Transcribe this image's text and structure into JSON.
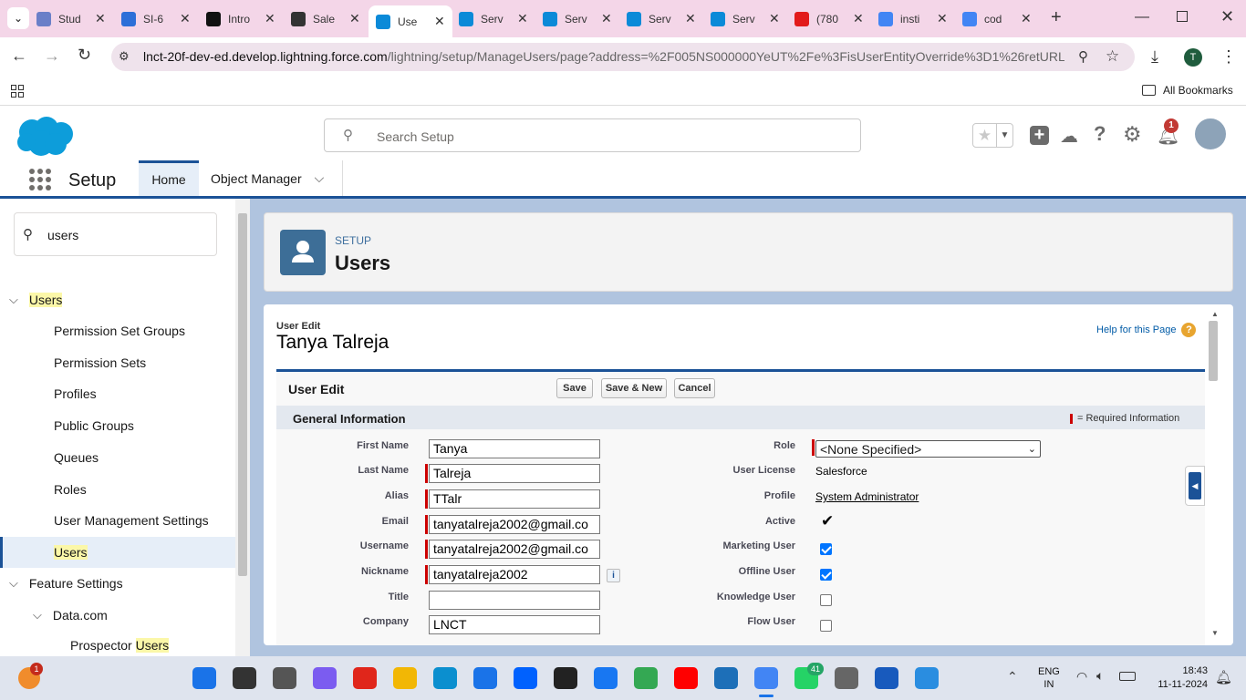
{
  "browser": {
    "tabs": [
      {
        "title": "Stud",
        "color": "#6a7fc8"
      },
      {
        "title": "SI-6",
        "color": "#2d6fd8"
      },
      {
        "title": "Intro",
        "color": "#111111"
      },
      {
        "title": "Sale",
        "color": "#333333"
      },
      {
        "title": "Use",
        "color": "#0b8ad8",
        "active": true
      },
      {
        "title": "Serv",
        "color": "#0b8ad8"
      },
      {
        "title": "Serv",
        "color": "#0b8ad8"
      },
      {
        "title": "Serv",
        "color": "#0b8ad8"
      },
      {
        "title": "Serv",
        "color": "#0b8ad8"
      },
      {
        "title": "(780",
        "color": "#e21b1b"
      },
      {
        "title": "insti",
        "color": "#4285f4"
      },
      {
        "title": "cod",
        "color": "#4285f4"
      }
    ],
    "url_host": "lnct-20f-dev-ed.develop.lightning.force.com",
    "url_path": "/lightning/setup/ManageUsers/page?address=%2F005NS000000YeUT%2Fe%3FisUserEntityOverride%3D1%26retURL...",
    "profile_initial": "T",
    "all_bookmarks": "All Bookmarks"
  },
  "sf": {
    "search_placeholder": "Search Setup",
    "notification_count": "1",
    "app_name": "Setup",
    "nav_home": "Home",
    "nav_object_manager": "Object Manager"
  },
  "sidebar": {
    "search_value": "users",
    "users": "Users",
    "items": [
      "Permission Set Groups",
      "Permission Sets",
      "Profiles",
      "Public Groups",
      "Queues",
      "Roles",
      "User Management Settings",
      "Users"
    ],
    "feature_settings": "Feature Settings",
    "data_com": "Data.com",
    "prospector_prefix": "Prospector ",
    "prospector_hl": "Users"
  },
  "page": {
    "eyebrow": "SETUP",
    "title": "Users",
    "user_edit_small": "User Edit",
    "user_name": "Tanya Talreja",
    "help_link": "Help for this Page",
    "section_title": "User Edit",
    "btn_save": "Save",
    "btn_save_new": "Save & New",
    "btn_cancel": "Cancel",
    "general_info": "General Information",
    "required_info": "= Required Information"
  },
  "form": {
    "left": [
      {
        "label": "First Name",
        "value": "Tanya",
        "required": false
      },
      {
        "label": "Last Name",
        "value": "Talreja",
        "required": true
      },
      {
        "label": "Alias",
        "value": "TTalr",
        "required": true
      },
      {
        "label": "Email",
        "value": "tanyatalreja2002@gmail.co",
        "required": true
      },
      {
        "label": "Username",
        "value": "tanyatalreja2002@gmail.co",
        "required": true
      },
      {
        "label": "Nickname",
        "value": "tanyatalreja2002",
        "required": true
      },
      {
        "label": "Title",
        "value": "",
        "required": false
      },
      {
        "label": "Company",
        "value": "LNCT",
        "required": false
      }
    ],
    "role_label": "Role",
    "role_value": "<None Specified>",
    "user_license_label": "User License",
    "user_license_value": "Salesforce",
    "profile_label": "Profile",
    "profile_value": "System Administrator",
    "active_label": "Active",
    "marketing_label": "Marketing User",
    "offline_label": "Offline User",
    "knowledge_label": "Knowledge User",
    "flow_label": "Flow User",
    "marketing_checked": true,
    "offline_checked": true,
    "knowledge_checked": false,
    "flow_checked": false
  },
  "taskbar": {
    "lang": "ENG",
    "region": "IN",
    "time": "18:43",
    "date": "11-11-2024",
    "whatsapp_badge": "41",
    "widget_badge": "1"
  }
}
